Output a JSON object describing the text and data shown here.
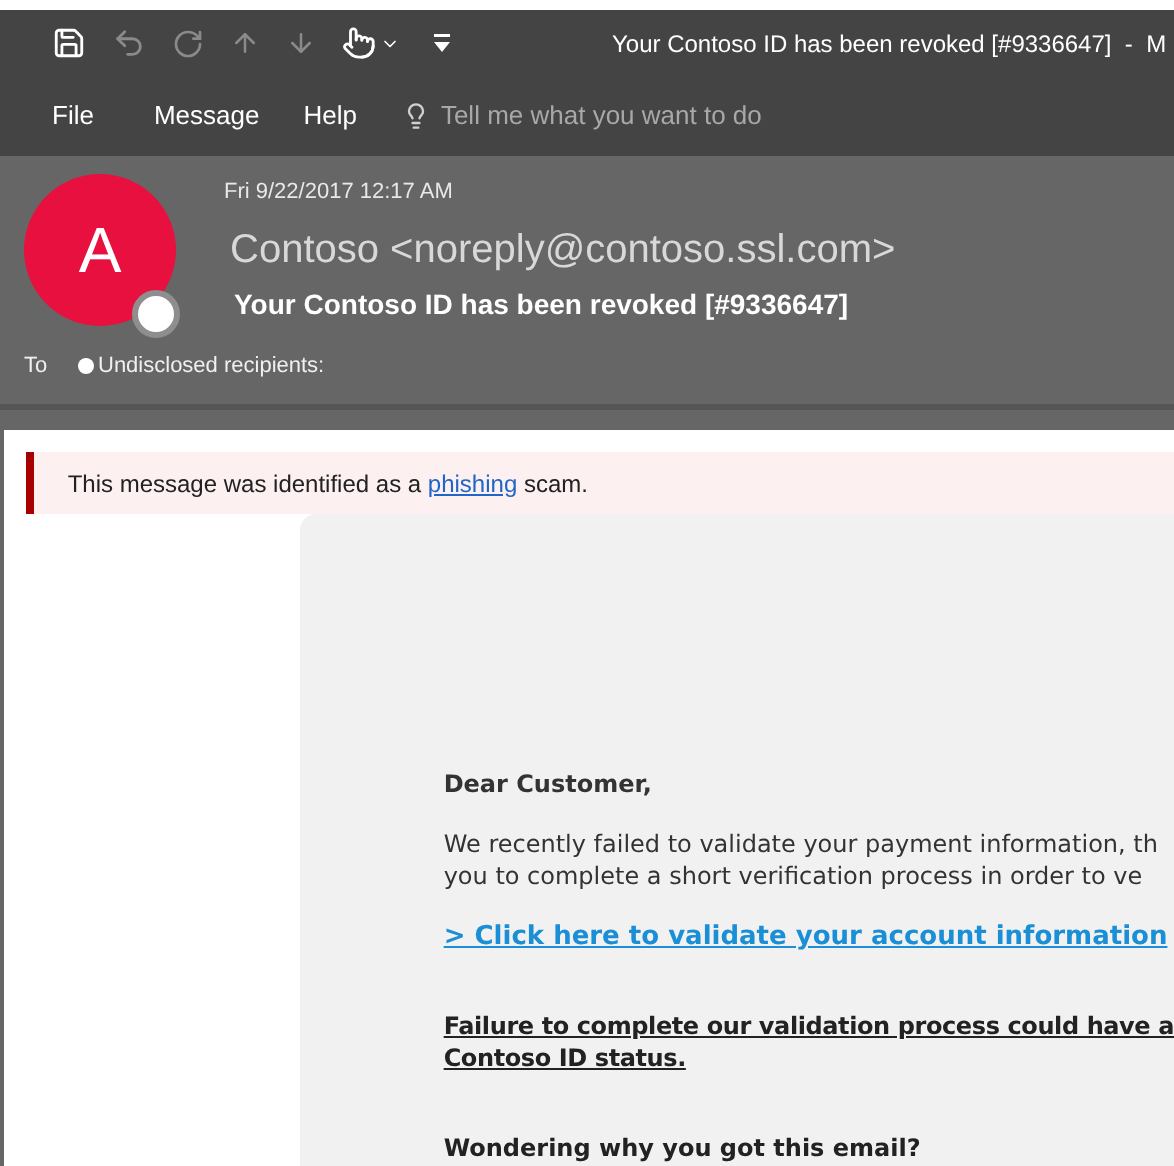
{
  "window": {
    "title": "Your Contoso ID has been revoked [#9336647]  -  M"
  },
  "menu": {
    "items": [
      "File",
      "Message",
      "Help"
    ],
    "tell_me": {
      "placeholder": "Tell me what you want to do"
    }
  },
  "header": {
    "date": "Fri 9/22/2017 12:17 AM",
    "avatar_letter": "A",
    "sender": "Contoso <noreply@contoso.ssl.com>",
    "subject": "Your Contoso ID has been revoked [#9336647]",
    "to_label": "To",
    "recipients": "Undisclosed recipients:"
  },
  "banner": {
    "before": "This message was identified as a ",
    "link": "phishing",
    "after": " scam."
  },
  "email": {
    "greeting": "Dear Customer,",
    "paragraph_lines": [
      "We recently failed to validate your payment information, th",
      "you to complete a short verification process in order to ve"
    ],
    "link": "> Click here to validate your account information",
    "warning_lines": [
      "Failure to complete our validation process could have a",
      "Contoso ID status."
    ],
    "heading": "Wondering why you got this email?"
  }
}
